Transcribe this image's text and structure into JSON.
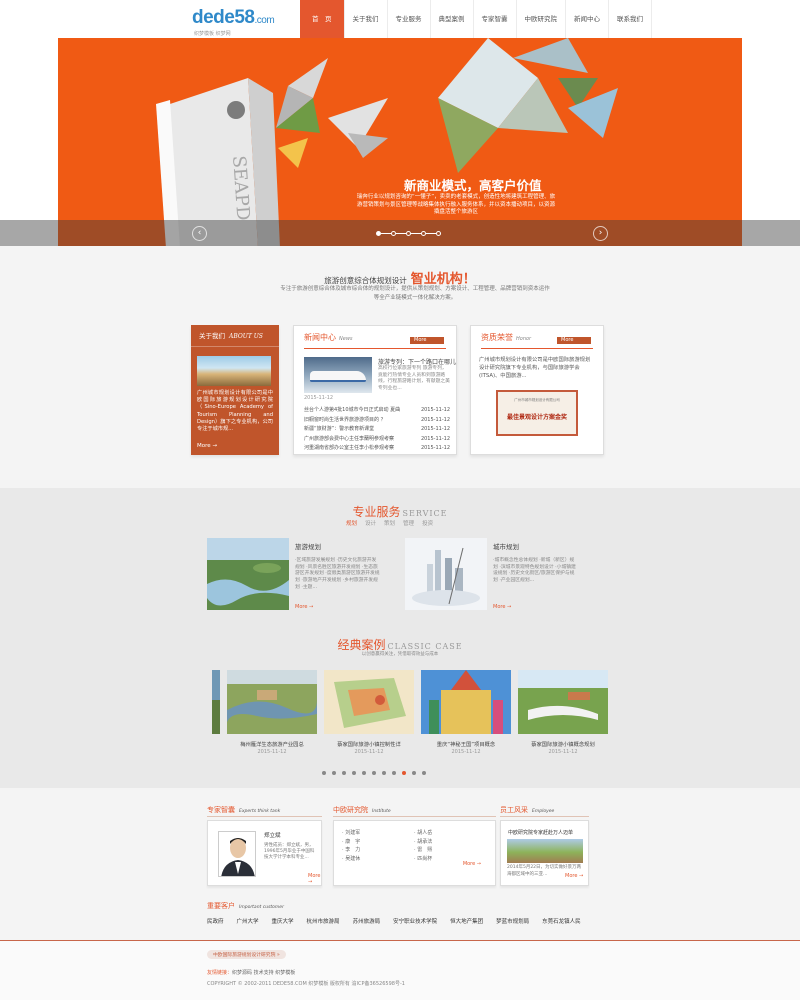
{
  "header": {
    "logo_main": "dede58",
    "logo_dom": ".com",
    "logo_sub": "织梦模板  织梦网",
    "nav": [
      "首　页",
      "关于我们",
      "专业服务",
      "典型案例",
      "专家智囊",
      "中欧研究院",
      "新闻中心",
      "联系我们"
    ],
    "active_index": 0
  },
  "banner": {
    "title": "新商业模式，高客户价值",
    "desc": "瑞奔行业以规划咨询的“一懂子”，卖卖的老套模式，创造性地将建筑工程管理、旅游营销策划与景区管理等战略集体执行融入服务体系，并以资本播动项目，以资源撬盘活整个旅游区",
    "prev": "‹",
    "next": "›"
  },
  "intro": {
    "prefix": "旅游创意综合体规划设计",
    "highlight": "智业机构！",
    "desc": "专注于旅游创意综合体及城市综合体的规划设计，提供从策划规划、方案设计、工程管理、品牌营销到资本运作等全产业链模式一体化解决方案。"
  },
  "about": {
    "title": "关于我们",
    "title_en": "ABOUT US",
    "text": "广州城市规划设计有限公司是中欧国际旅游规划设计研究院（Sino-Europe Academy of Tourism Planning and Design）旗下之专业机构，公司专注于城市规...",
    "more": "More →"
  },
  "news": {
    "title": "新闻中心",
    "title_en": "News",
    "more": "More",
    "feature_title": "旅游专列：下一个路口在哪儿",
    "feature_desc": "高校行位家旅游专列 旅游专列，竟能行热情专业人员和到旅游路线，行程旅游路计划，有献题之美专列业也...",
    "feature_date": "2015-11-12",
    "rows": [
      {
        "title": "丝台个人游第4批10城市今日正式启动 夏曲",
        "date": "2015-11-12"
      },
      {
        "title": "旧橱窗时尚生活世界旅游游项目的 ？",
        "date": "2015-11-12"
      },
      {
        "title": "新疆“旅财游”：警示教育新课堂",
        "date": "2015-11-12"
      },
      {
        "title": "广州旅游部会费中心主任李蘭明参观考察",
        "date": "2015-11-12"
      },
      {
        "title": "河重湖南省部办公室主任李小松参观考察",
        "date": "2015-11-12"
      }
    ]
  },
  "honor": {
    "title": "资质荣誉",
    "title_en": "Honor",
    "more": "More",
    "text": "广州城市规划设计有限公司是中欧国际旅游规划设计研究院旗下专业机构，与国际旅游学会(ITSA)、中国旅游...",
    "cert_title": "广州市城市规划设计有限公司",
    "cert_main": "最佳景观设计方案金奖"
  },
  "services": {
    "title": "专业服务",
    "title_en": "SERVICE",
    "tabs": [
      "规划",
      "设计",
      "策划",
      "管理",
      "投资"
    ],
    "items": [
      {
        "name": "旅游规划",
        "desc": "·区域旅游发展规划 ·历史文化旅游开发规划 ·风景名胜区旅游开发规划 ·生态旅游区开发规划 ·度假类旅游区旅游开发规划 ·旅游地产开发规划 ·乡村旅游开发规划 ·主题...",
        "more": "More →"
      },
      {
        "name": "城市规划",
        "desc": "·城市概念性总体规划 ·新城（新区）规划 ·滨城市景观特色规划设计 ·小城镇建设规划 ·历史文化街区/旅游区保护与规划 ·产业园区规划...",
        "more": "More →"
      }
    ]
  },
  "cases": {
    "title": "经典案例",
    "title_en": "CLASSIC CASE",
    "subtitle": "以创意赢得关注，凭借取得效益与成本",
    "items": [
      {
        "caption": "梅州雁洋生态旅游产业园总",
        "date": "2015-11-12"
      },
      {
        "caption": "蔡家国际旅游小镇控制性详",
        "date": "2015-11-12"
      },
      {
        "caption": "重庆“神秘王国”项目概念",
        "date": "2015-11-12"
      },
      {
        "caption": "蔡家国际旅游小镇概念规划",
        "date": "2015-11-12"
      }
    ],
    "dot_count": 11,
    "active_dot": 8
  },
  "experts": {
    "title": "专家智囊",
    "title_en": "Experts think tank",
    "name": "郑立斌",
    "desc": "男性成员：郑立斌，男，1996年5月毕业于中国科技大学计学本科专业...",
    "more": "More →"
  },
  "institute": {
    "title": "中欧研究院",
    "title_en": "Institute",
    "col1": [
      "刘建军",
      "康　宇",
      "李　力",
      "吴建休"
    ],
    "col2": [
      "胡人岳",
      "胡承法",
      "雷　熙",
      "匹尚杯"
    ],
    "more": "More →"
  },
  "employee": {
    "title": "员工风采",
    "title_en": "Employee",
    "headline": "中欧研究院专家赶赴万人迈单",
    "desc": "2014年5月22日，为切实做好景万两海都区域中的三亚…",
    "more": "More →"
  },
  "clients": {
    "title": "重要客户",
    "title_en": "Important customer",
    "items": [
      "民政府",
      "广州大学",
      "重庆大学",
      "杭州市旅游局",
      "苏州旅游局",
      "安宁职业技术学院",
      "恒大地产集团",
      "梦蓝市规划局",
      "东莞石龙镇人民"
    ]
  },
  "footer": {
    "badge": "中欧国际旅游规划设计研究院 »",
    "links_label": "友情链接：",
    "links": "织梦源码  技术支持  织梦模板",
    "copyright": "COPYRIGHT © 2002-2011 DEDE58.COM 织梦模板 版权所有  渝ICP备36526598号-1"
  }
}
